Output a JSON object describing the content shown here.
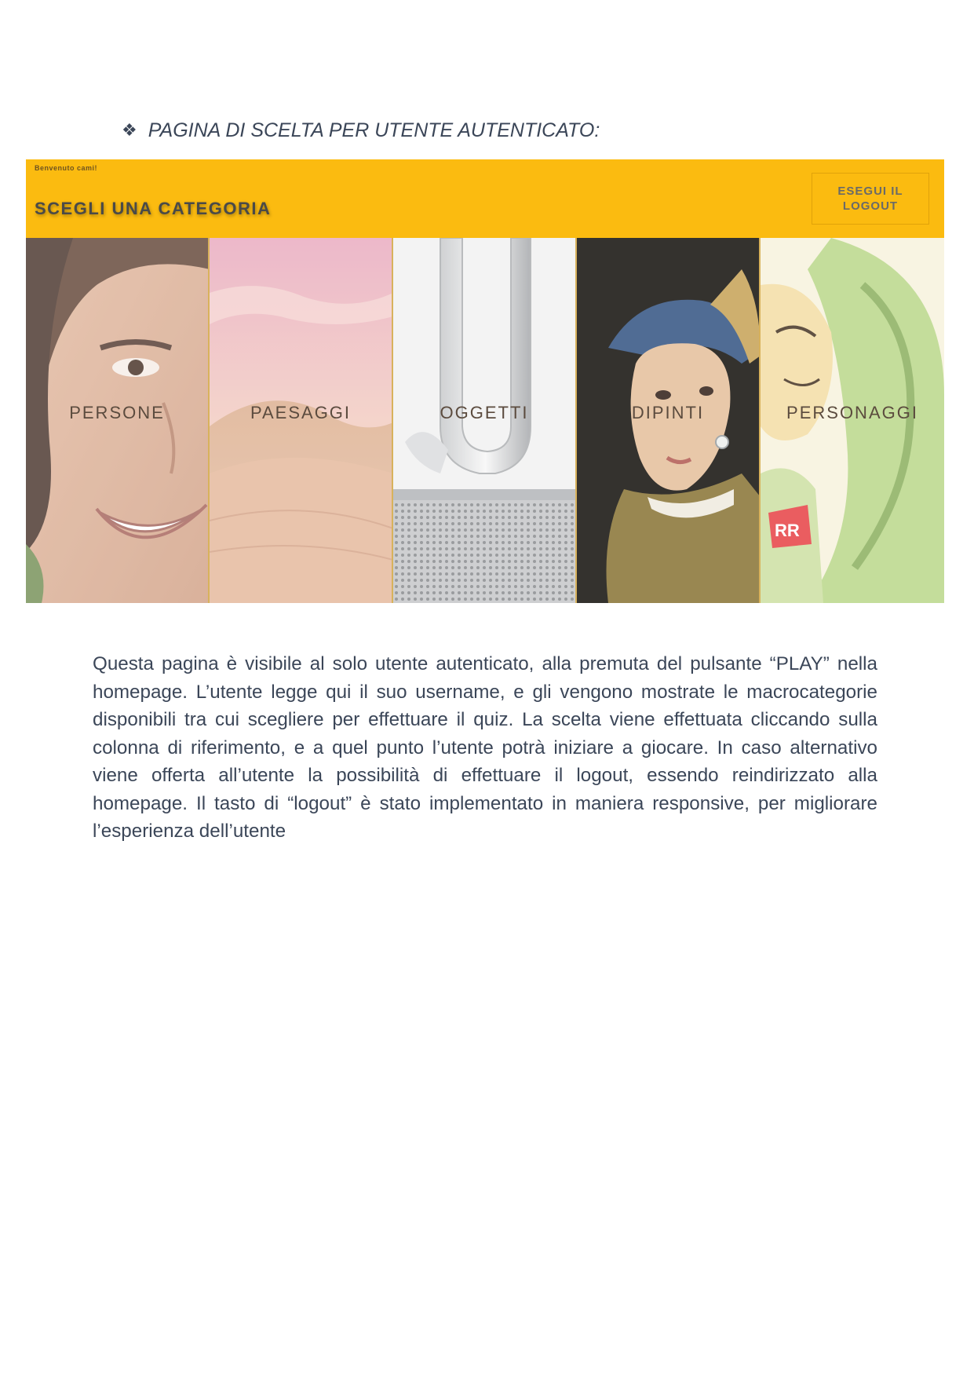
{
  "heading": {
    "bullet_icon": "diamond-bullet-icon",
    "text": "PAGINA DI SCELTA PER UTENTE AUTENTICATO:"
  },
  "screenshot": {
    "welcome": "Benvenuto cami!",
    "title": "SCEGLI UNA CATEGORIA",
    "logout_button": "ESEGUI IL LOGOUT",
    "colors": {
      "header_bar": "#fbbb10",
      "column_divider": "#d8b25c"
    },
    "categories": [
      {
        "label": "PERSONE",
        "image": "smiling-woman-face"
      },
      {
        "label": "PAESAGGI",
        "image": "desert-dunes-pink-sky"
      },
      {
        "label": "OGGETTI",
        "image": "silver-bladeless-fan"
      },
      {
        "label": "DIPINTI",
        "image": "girl-with-pearl-earring-painting"
      },
      {
        "label": "PERSONAGGI",
        "image": "green-cartoon-character-rr"
      }
    ]
  },
  "paragraph": "Questa pagina è visibile al solo utente autenticato, alla premuta del pulsante “PLAY” nella homepage. L’utente legge qui il suo username, e gli vengono mostrate le macrocategorie disponibili tra cui scegliere per effettuare il quiz. La scelta viene effettuata cliccando sulla colonna di riferimento, e a quel punto l’utente potrà iniziare a giocare. In caso alternativo viene offerta all’utente la possibilità di effettuare il logout, essendo reindirizzato alla homepage. Il tasto di “logout” è stato implementato in maniera responsive, per migliorare l’esperienza dell’utente"
}
